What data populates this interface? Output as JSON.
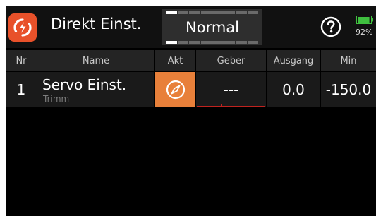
{
  "header": {
    "title": "Direkt Einst.",
    "mode": "Normal",
    "mode_segment_count": 8,
    "mode_active_segment": 1,
    "battery_percent": "92%",
    "battery_level": 0.92
  },
  "table": {
    "columns": [
      "Nr",
      "Name",
      "Akt",
      "Geber",
      "Ausgang",
      "Min"
    ],
    "rows": [
      {
        "nr": "1",
        "name": "Servo Einst.",
        "sub": "Trimm",
        "akt_icon": "compass-icon",
        "geber": "---",
        "ausgang": "0.0",
        "min": "-150.0"
      }
    ]
  },
  "colors": {
    "accent": "#e8512a",
    "akt_cell": "#e8803a",
    "battery": "#3fbf3f",
    "geber_bar": "#c0231f"
  }
}
